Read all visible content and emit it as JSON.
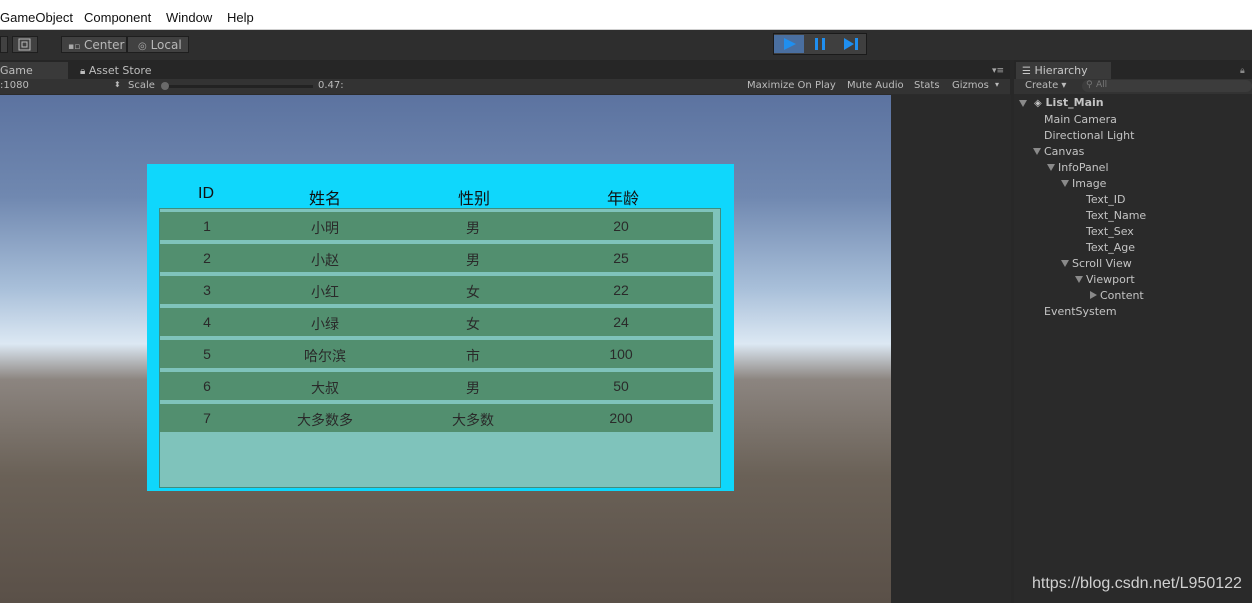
{
  "menu": {
    "items": [
      "GameObject",
      "Component",
      "Window",
      "Help"
    ]
  },
  "toolbar": {
    "center_label": "Center",
    "local_label": "Local"
  },
  "tabs": {
    "game": "Game",
    "asset_store": "Asset Store"
  },
  "game_toolbar": {
    "resolution": ":1080",
    "scale_label": "Scale",
    "scale_value": "0.47:",
    "maximize": "Maximize On Play",
    "mute": "Mute Audio",
    "stats": "Stats",
    "gizmos": "Gizmos"
  },
  "hierarchy": {
    "tab": "Hierarchy",
    "create": "Create",
    "search_placeholder": "All",
    "scene": "List_Main",
    "items": [
      "Main Camera",
      "Directional Light",
      "Canvas",
      "InfoPanel",
      "Image",
      "Text_ID",
      "Text_Name",
      "Text_Sex",
      "Text_Age",
      "Scroll View",
      "Viewport",
      "Content",
      "EventSystem"
    ]
  },
  "table": {
    "headers": [
      "ID",
      "姓名",
      "性别",
      "年龄"
    ],
    "rows": [
      [
        "1",
        "小明",
        "男",
        "20"
      ],
      [
        "2",
        "小赵",
        "男",
        "25"
      ],
      [
        "3",
        "小红",
        "女",
        "22"
      ],
      [
        "4",
        "小绿",
        "女",
        "24"
      ],
      [
        "5",
        "哈尔滨",
        "市",
        "100"
      ],
      [
        "6",
        "大叔",
        "男",
        "50"
      ],
      [
        "7",
        "大多数多",
        "大多数",
        "200"
      ]
    ]
  },
  "watermark": "https://blog.csdn.net/L950122",
  "colors": {
    "panel": "#0fd7fc",
    "row": "#528f6f",
    "scroll": "#7fc3bb",
    "play_active": "#4a8fd8"
  }
}
